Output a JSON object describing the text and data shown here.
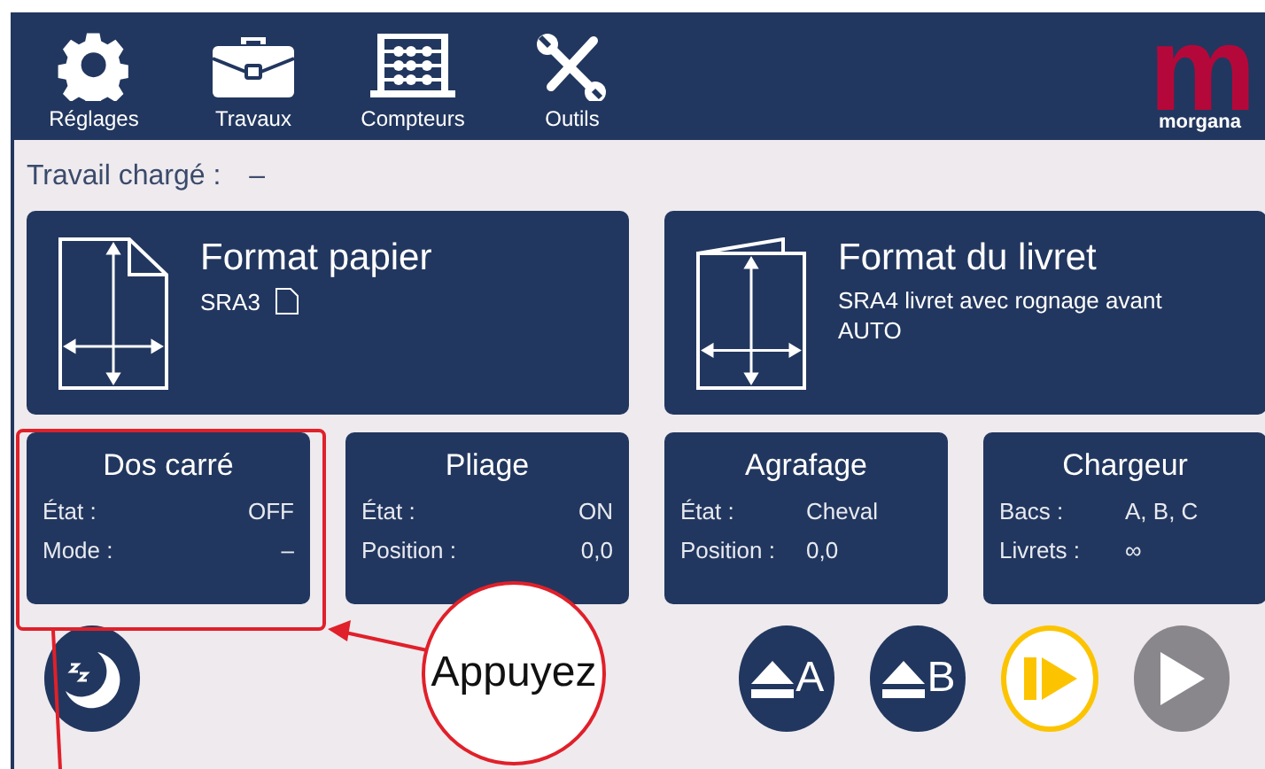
{
  "header": {
    "nav": [
      {
        "kind": "settings",
        "label": "Réglages"
      },
      {
        "kind": "jobs",
        "label": "Travaux"
      },
      {
        "kind": "counters",
        "label": "Compteurs"
      },
      {
        "kind": "tools",
        "label": "Outils"
      }
    ],
    "logo": {
      "letter": "m",
      "name": "morgana"
    }
  },
  "job": {
    "label": "Travail chargé :",
    "value": "–"
  },
  "format_cards": [
    {
      "kind": "sheet",
      "title": "Format papier",
      "lines": [
        "SRA3"
      ],
      "sheet_icon": true
    },
    {
      "kind": "booklet",
      "title": "Format du livret",
      "lines": [
        "SRA4 livret avec rognage avant",
        "AUTO"
      ],
      "sheet_icon": false
    }
  ],
  "status_cards": [
    {
      "title": "Dos carré",
      "rows": [
        {
          "label": "État :",
          "value": "OFF"
        },
        {
          "label": "Mode :",
          "value": "–"
        }
      ]
    },
    {
      "title": "Pliage",
      "rows": [
        {
          "label": "État :",
          "value": "ON"
        },
        {
          "label": "Position :",
          "value": "0,0"
        }
      ]
    },
    {
      "title": "Agrafage",
      "rows": [
        {
          "label": "État :",
          "value": "Cheval"
        },
        {
          "label": "Position :",
          "value": "0,0"
        }
      ]
    },
    {
      "title": "Chargeur",
      "rows": [
        {
          "label": "Bacs :",
          "value": "A, B, C"
        },
        {
          "label": "Livrets :",
          "value": "∞"
        }
      ]
    }
  ],
  "controls": [
    {
      "kind": "sleep",
      "disabled": false
    },
    {
      "kind": "eject",
      "label": "A",
      "disabled": false
    },
    {
      "kind": "eject",
      "label": "B",
      "disabled": false
    },
    {
      "kind": "step",
      "disabled": false
    },
    {
      "kind": "play",
      "disabled": true
    }
  ],
  "annotation": {
    "callout": "Appuyez"
  }
}
